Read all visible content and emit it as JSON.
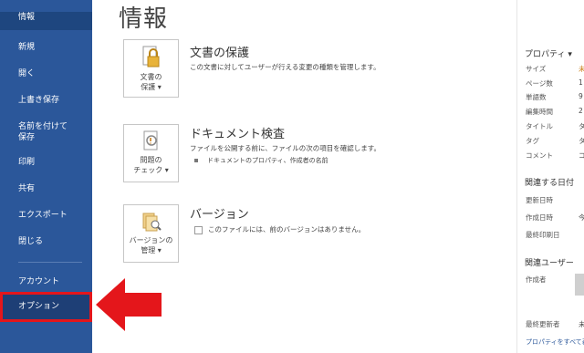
{
  "sidebar": {
    "items": [
      {
        "label": "情報"
      },
      {
        "label": "新規"
      },
      {
        "label": "開く"
      },
      {
        "label": "上書き保存"
      },
      {
        "label": "名前を付けて\n保存"
      },
      {
        "label": "印刷"
      },
      {
        "label": "共有"
      },
      {
        "label": "エクスポート"
      },
      {
        "label": "閉じる"
      },
      {
        "label": "アカウント"
      },
      {
        "label": "オプション"
      }
    ]
  },
  "main": {
    "title": "情報",
    "sections": [
      {
        "tile_label_1": "文書の",
        "tile_label_2": "保護 ▾",
        "title": "文書の保護",
        "desc": "この文書に対してユーザーが行える変更の種類を管理します。"
      },
      {
        "tile_label_1": "問題の",
        "tile_label_2": "チェック ▾",
        "title": "ドキュメント検査",
        "desc": "ファイルを公開する前に、ファイルの次の項目を確認します。",
        "bullet": "ドキュメントのプロパティ、作成者の名前"
      },
      {
        "tile_label_1": "バージョンの",
        "tile_label_2": "管理 ▾",
        "title": "バージョン",
        "desc": "このファイルには、前のバージョンはありません。"
      }
    ]
  },
  "properties": {
    "heading": "プロパティ ▾",
    "rows": [
      {
        "label": "サイズ",
        "value": "未"
      },
      {
        "label": "ページ数",
        "value": "1"
      },
      {
        "label": "単語数",
        "value": "9"
      },
      {
        "label": "編集時間",
        "value": "2"
      },
      {
        "label": "タイトル",
        "value": "タ"
      },
      {
        "label": "タグ",
        "value": "タ"
      },
      {
        "label": "コメント",
        "value": "コ"
      }
    ],
    "dates_heading": "関連する日付",
    "dates": [
      {
        "label": "更新日時",
        "value": ""
      },
      {
        "label": "作成日時",
        "value": "今"
      },
      {
        "label": "最終印刷日",
        "value": ""
      }
    ],
    "users_heading": "関連ユーザー",
    "users": [
      {
        "label": "作成者"
      },
      {
        "label": "最終更新者",
        "value": "未"
      }
    ],
    "link": "プロパティをすべて表"
  },
  "colors": {
    "sidebar": "#2b579a",
    "highlight": "#e4161b"
  }
}
